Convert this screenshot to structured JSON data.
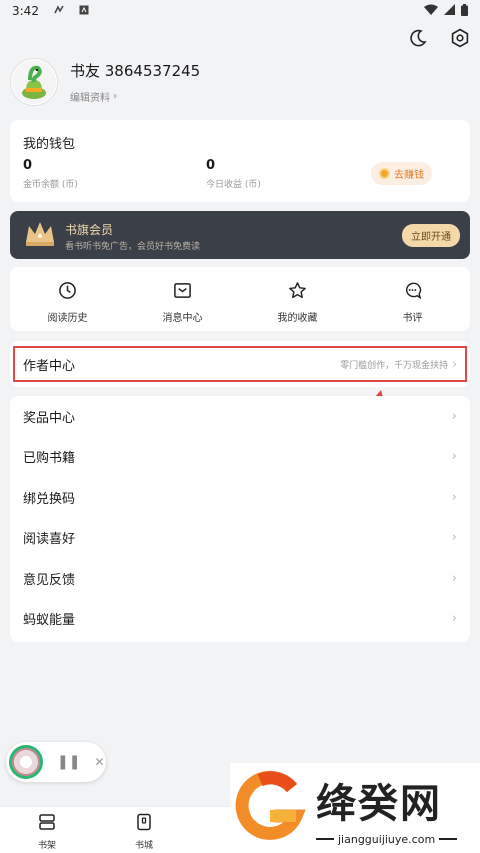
{
  "status_bar": {
    "time": "3:42"
  },
  "profile": {
    "username": "书友 3864537245",
    "edit_label": "编辑资料"
  },
  "wallet": {
    "title": "我的钱包",
    "coin_balance": "0",
    "coin_label": "金币余额 (币)",
    "today_income": "0",
    "today_label": "今日收益 (币)",
    "earn_button": "去赚钱"
  },
  "vip": {
    "title": "书旗会员",
    "subtitle": "看书听书免广告，会员好书免费读",
    "button": "立即开通"
  },
  "shortcuts": [
    {
      "label": "阅读历史",
      "icon": "clock-icon"
    },
    {
      "label": "消息中心",
      "icon": "message-icon"
    },
    {
      "label": "我的收藏",
      "icon": "star-icon"
    },
    {
      "label": "书评",
      "icon": "comment-icon"
    }
  ],
  "author_center": {
    "title": "作者中心",
    "hint": "零门槛创作，千万现金扶持"
  },
  "menu": [
    {
      "label": "奖品中心"
    },
    {
      "label": "已购书籍"
    },
    {
      "label": "绑兑换码"
    },
    {
      "label": "阅读喜好"
    },
    {
      "label": "意见反馈"
    },
    {
      "label": "蚂蚁能量"
    }
  ],
  "tabbar": [
    {
      "label": "书架"
    },
    {
      "label": "书城"
    }
  ],
  "watermark": {
    "name": "绛癸网",
    "url": "jiangguijiuye.com"
  },
  "colors": {
    "accent_red": "#e04646",
    "vip_gold": "#f3d9aa",
    "green": "#2bb673"
  }
}
